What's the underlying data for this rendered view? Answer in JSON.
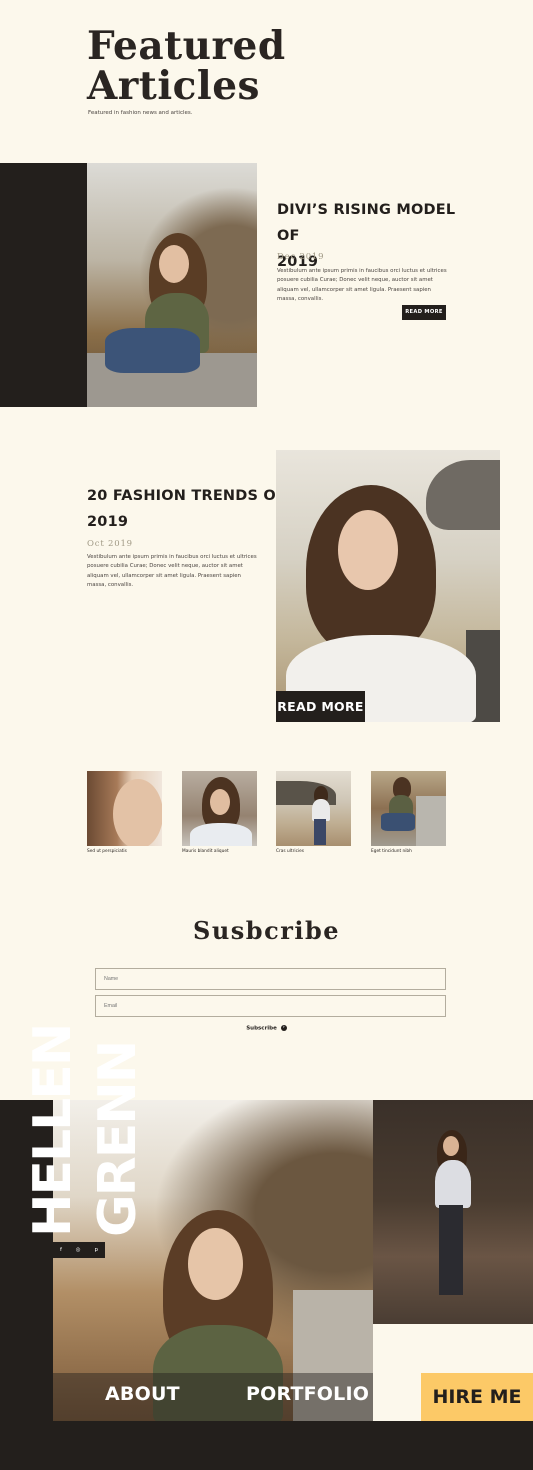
{
  "hero": {
    "title_line1": "Featured",
    "title_line2": "Articles",
    "subtitle": "Featured in fashion news and articles."
  },
  "article1": {
    "title_line1": "DIVI’S RISING MODEL OF",
    "title_line2": "2019",
    "date": "Dec 2019",
    "text": "Vestibulum ante ipsum primis in faucibus orci luctus et ultrices posuere cubilia Curae; Donec velit neque, auctor sit amet aliquam vel, ullamcorper sit amet ligula. Praesent sapien massa, convallis.",
    "button": "READ MORE"
  },
  "article2": {
    "title_line1": "20 FASHION TRENDS OF",
    "title_line2": "2019",
    "date": "Oct 2019",
    "text": "Vestibulum ante ipsum primis in faucibus orci luctus et ultrices posuere cubilia Curae; Donec velit neque, auctor sit amet aliquam vel, ullamcorper sit amet ligula. Praesent sapien massa, convallis.",
    "button": "READ MORE"
  },
  "thumbnails": [
    {
      "caption": "Sed ut perspiciatis"
    },
    {
      "caption": "Mauris blandit aliquet"
    },
    {
      "caption": "Cras ultricies"
    },
    {
      "caption": "Eget tincidunt nibh"
    }
  ],
  "subscribe": {
    "title": "Susbcribe",
    "name_placeholder": "Name",
    "email_placeholder": "Email",
    "link": "Subscribe",
    "arrow": "›"
  },
  "footer": {
    "name_first": "HELLEN",
    "name_last": "GRENN",
    "social": [
      "f",
      "◎",
      "p"
    ],
    "nav_about": "ABOUT",
    "nav_portfolio": "PORTFOLIO",
    "hire": "HIRE ME"
  },
  "colors": {
    "background": "#fcf8ec",
    "dark": "#231f1c",
    "accent": "#fcc967",
    "date": "#a19a86"
  }
}
